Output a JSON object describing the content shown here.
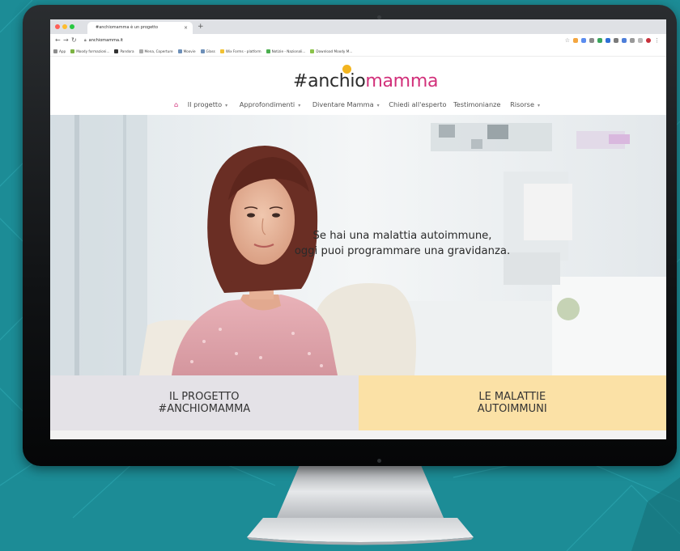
{
  "browser": {
    "tab_title": "#anchiomamma è un progetto",
    "tab_close": "×",
    "new_tab": "+",
    "url": "anchiomamma.it",
    "bookmarks": [
      "App",
      "Moody formazioni...",
      "Pandora",
      "Mena, Coperture",
      "Moovie",
      "Glass",
      "Wix Forms - platform",
      "Notizie - Nazionali...",
      "Download Moody M..."
    ]
  },
  "site": {
    "logo_prefix": "#anchio",
    "logo_suffix": "mamma",
    "nav": {
      "items": [
        {
          "label": "Il progetto",
          "caret": true
        },
        {
          "label": "Approfondimenti",
          "caret": true
        },
        {
          "label": "Diventare Mamma",
          "caret": true
        },
        {
          "label": "Chiedi all'esperto",
          "caret": false
        },
        {
          "label": "Testimonianze",
          "caret": false
        },
        {
          "label": "Risorse",
          "caret": true
        }
      ],
      "caret_glyph": "▾"
    },
    "hero": {
      "line1": "Se hai una malattia autoimmune,",
      "line2": "oggi puoi programmare una gravidanza."
    },
    "tiles": [
      {
        "line1": "IL PROGETTO",
        "line2": "#ANCHIOMAMMA"
      },
      {
        "line1": "LE MALATTIE",
        "line2": "AUTOIMMUNI"
      }
    ]
  },
  "colors": {
    "background": "#1c8c96",
    "brand_pink": "#d2307a",
    "brand_yellow": "#f3b51f",
    "tile_gray": "#e4e2e7",
    "tile_yellow": "#fbe1a6"
  },
  "icons": [
    "home-icon",
    "lock-icon",
    "back-arrow-icon",
    "forward-arrow-icon",
    "reload-icon",
    "star-icon",
    "extension-icons",
    "profile-icon"
  ]
}
